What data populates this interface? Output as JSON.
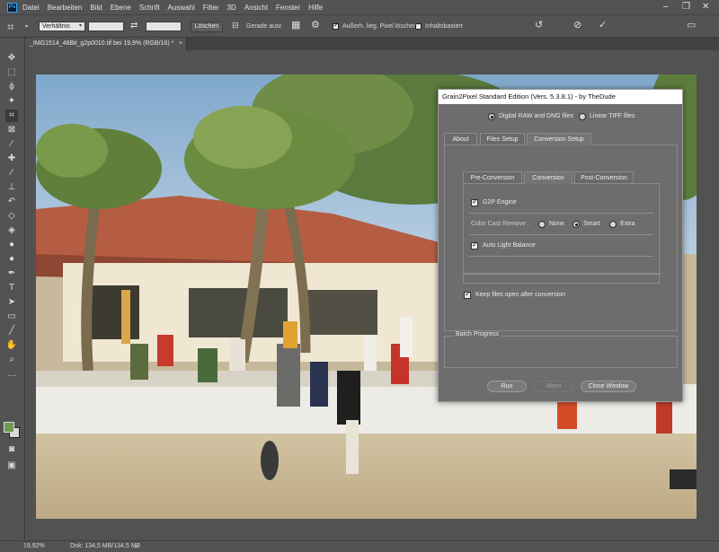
{
  "menubar": {
    "app_icon": "Ps",
    "items": [
      "Datei",
      "Bearbeiten",
      "Bild",
      "Ebene",
      "Schrift",
      "Auswahl",
      "Filter",
      "3D",
      "Ansicht",
      "Fenster",
      "Hilfe"
    ],
    "window_controls": [
      "–",
      "❐",
      "✕"
    ]
  },
  "options": {
    "ratio_select": "Verhältnis",
    "swap_icon": "⇄",
    "clear_label": "Löschen",
    "straighten_label": "Gerade ausr.",
    "delete_cropped_label": "Außerh. lieg. Pixel löschen",
    "delete_cropped_checked": true,
    "content_aware_label": "Inhaltsbasiert",
    "content_aware_checked": false
  },
  "document": {
    "tab_title": "_IMG1514_48Bit_g2p0010.tif bei 19,9% (RGB/16) *",
    "tab_close": "×"
  },
  "status": {
    "zoom": "19,92%",
    "doc_info": "Dok: 134,5 MB/134,5 MB",
    "more": "›"
  },
  "dialog": {
    "title": "Grain2Pixel Standard Edition (Vers. 5.3.8.1) - by TheDude",
    "source_options": [
      {
        "label": "Digital RAW and DNG files",
        "selected": true
      },
      {
        "label": "Linear TIFF files",
        "selected": false
      }
    ],
    "main_tabs": [
      "About",
      "Files Setup",
      "Conversion Setup"
    ],
    "main_tab_selected": "Conversion Setup",
    "sub_tabs": [
      "Pre-Conversion",
      "Conversion",
      "Post-Conversion"
    ],
    "sub_tab_selected": "Conversion",
    "g2p_engine_label": "G2P Engine",
    "g2p_engine_checked": true,
    "color_cast_label": "Color Cast Remove :",
    "color_cast_options": [
      {
        "label": "None",
        "selected": false
      },
      {
        "label": "Smart",
        "selected": true
      },
      {
        "label": "Extra",
        "selected": false
      }
    ],
    "auto_light_label": "Auto Light Balance",
    "auto_light_checked": true,
    "keep_open_label": "Keep files open after conversion",
    "keep_open_checked": true,
    "batch_progress_label": "Batch Progress",
    "buttons": {
      "run": "Run",
      "abort": "Abort",
      "close": "Close Window"
    }
  },
  "colors": {
    "ui_bg": "#535353",
    "dialog_bg": "#6d6d6d",
    "ps_blue": "#31a8ff",
    "sky": "#8fb6d6",
    "sand": "#c9b794"
  }
}
